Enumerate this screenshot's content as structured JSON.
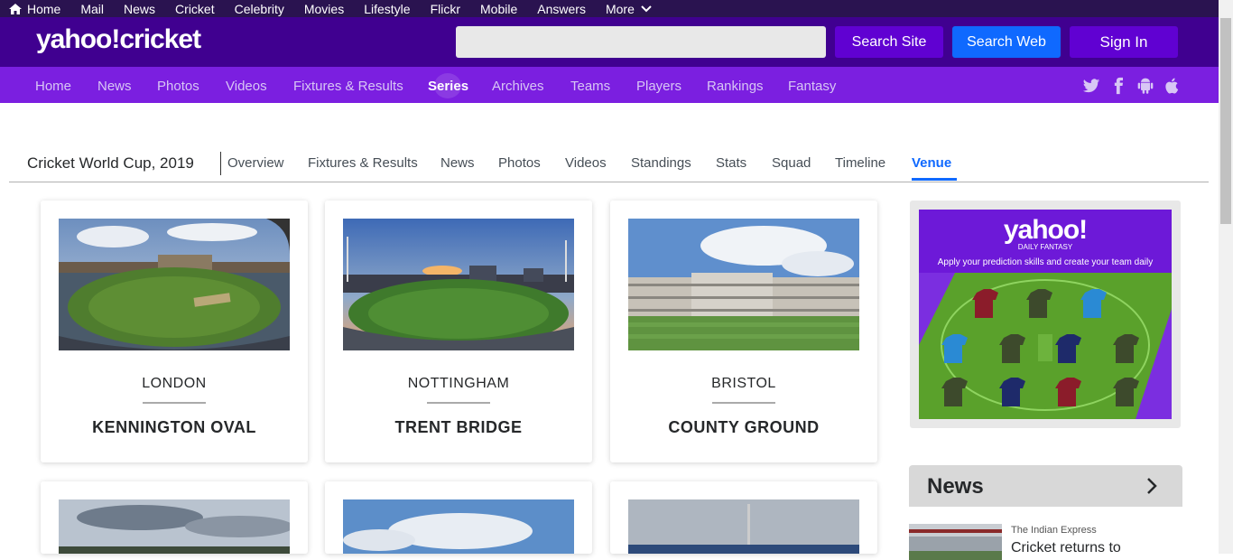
{
  "topbar": {
    "items": [
      "Home",
      "Mail",
      "News",
      "Cricket",
      "Celebrity",
      "Movies",
      "Lifestyle",
      "Flickr",
      "Mobile",
      "Answers",
      "More"
    ]
  },
  "header": {
    "logo": "yahoo!cricket",
    "search_placeholder": "",
    "search_site_label": "Search Site",
    "search_web_label": "Search Web",
    "sign_in_label": "Sign In"
  },
  "nav": {
    "items": [
      "Home",
      "News",
      "Photos",
      "Videos",
      "Fixtures & Results",
      "Series",
      "Archives",
      "Teams",
      "Players",
      "Rankings",
      "Fantasy"
    ],
    "active": "Series",
    "social_icons": [
      "twitter-icon",
      "facebook-icon",
      "android-icon",
      "apple-icon"
    ]
  },
  "series": {
    "title": "Cricket World Cup, 2019",
    "tabs": [
      "Overview",
      "Fixtures & Results",
      "News",
      "Photos",
      "Videos",
      "Standings",
      "Stats",
      "Squad",
      "Timeline",
      "Venue"
    ],
    "active_tab": "Venue"
  },
  "venues": [
    {
      "city": "LONDON",
      "name": "KENNINGTON OVAL"
    },
    {
      "city": "NOTTINGHAM",
      "name": "TRENT BRIDGE"
    },
    {
      "city": "BRISTOL",
      "name": "COUNTY GROUND"
    }
  ],
  "ad": {
    "logo": "yahoo!",
    "subtitle": "DAILY FANTASY",
    "tagline": "Apply your prediction skills and create your team daily"
  },
  "news": {
    "heading": "News",
    "items": [
      {
        "source": "The Indian Express",
        "title": "Cricket returns to"
      }
    ]
  },
  "colors": {
    "topbar": "#2a1350",
    "header": "#400090",
    "nav": "#7b1fe0",
    "search_web": "#0f69ff",
    "active_tab": "#0f69ff"
  }
}
